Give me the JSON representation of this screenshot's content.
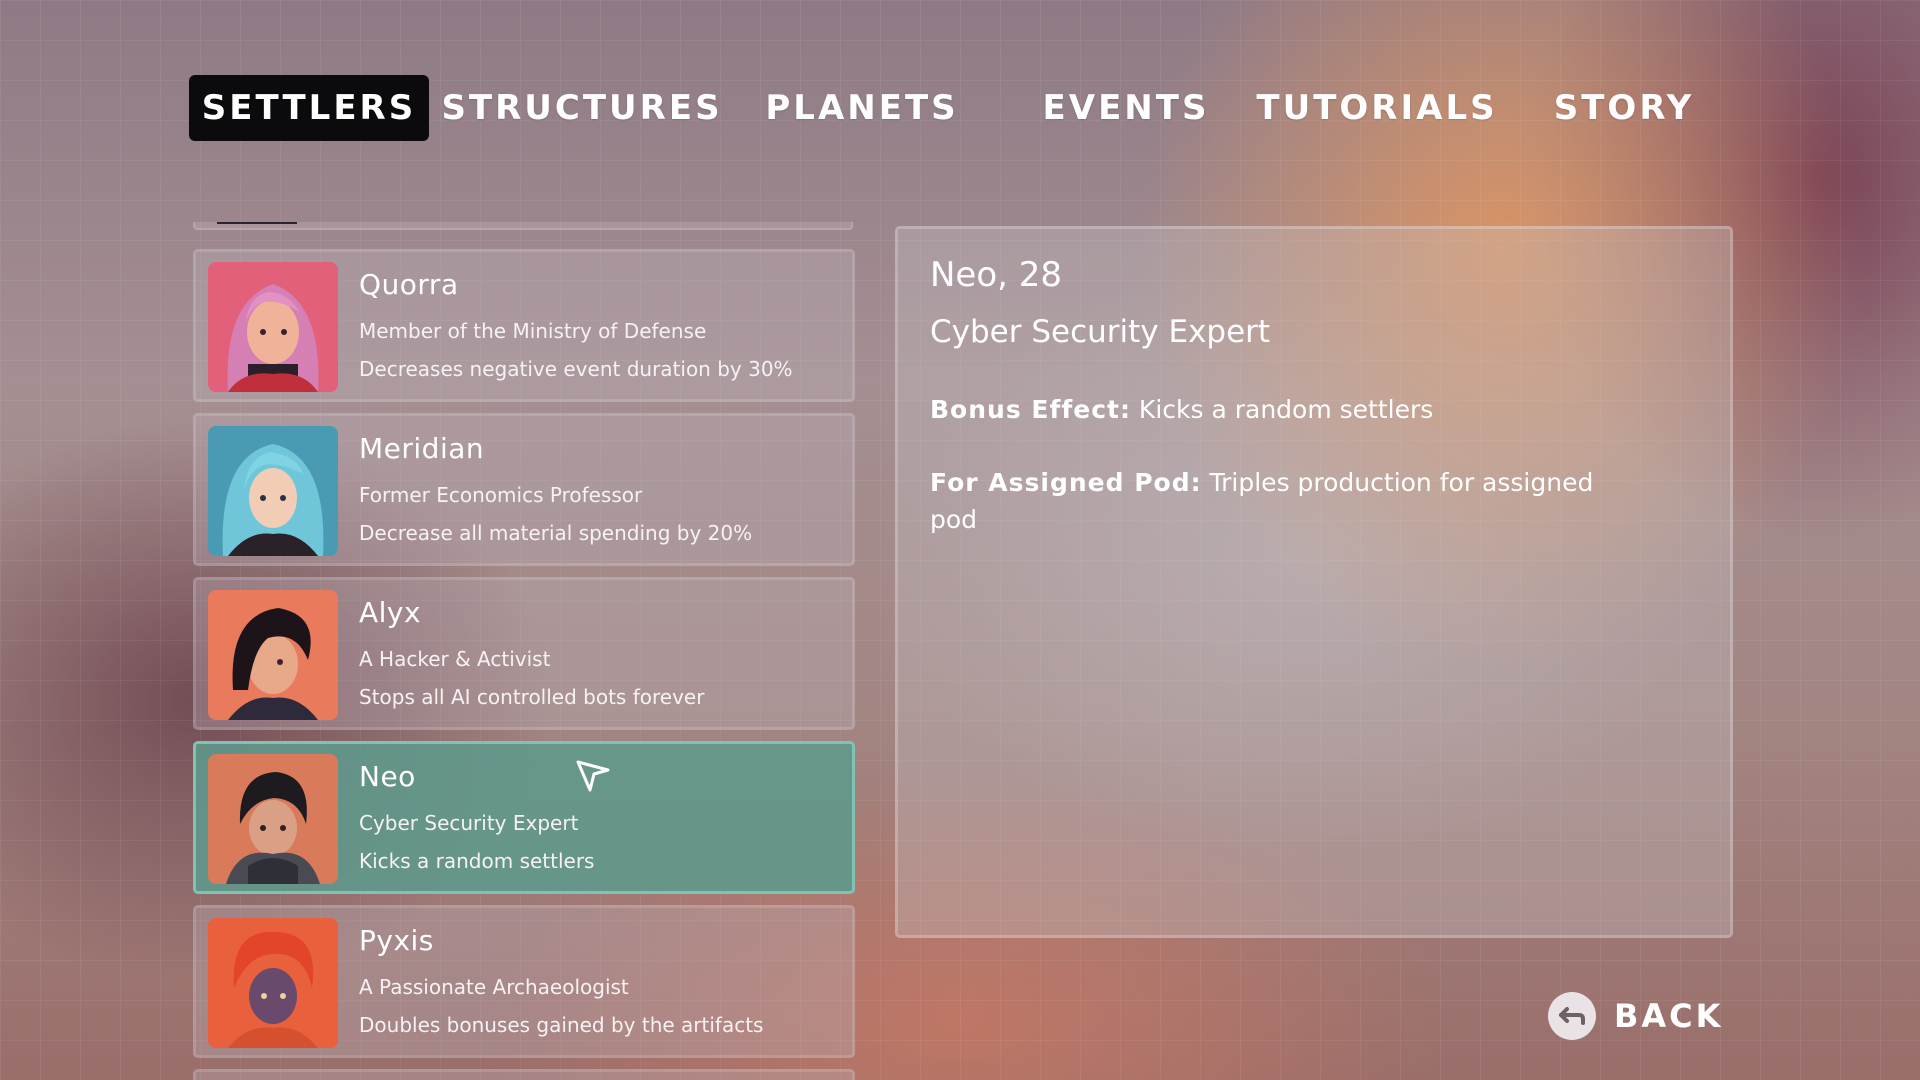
{
  "tabs": [
    {
      "label": "SETTLERS",
      "active": true
    },
    {
      "label": "STRUCTURES",
      "active": false
    },
    {
      "label": "PLANETS",
      "active": false
    },
    {
      "label": "EVENTS",
      "active": false
    },
    {
      "label": "TUTORIALS",
      "active": false
    },
    {
      "label": "STORY",
      "active": false
    }
  ],
  "settlers": [
    {
      "name": "Quorra",
      "role": "Member of the Ministry of Defense",
      "effect": "Decreases negative event duration by 30%",
      "portrait": "quorra-portrait"
    },
    {
      "name": "Meridian",
      "role": "Former Economics Professor",
      "effect": "Decrease all material spending by 20%",
      "portrait": "meridian-portrait"
    },
    {
      "name": "Alyx",
      "role": "A Hacker & Activist",
      "effect": "Stops all AI controlled bots forever",
      "portrait": "alyx-portrait"
    },
    {
      "name": "Neo",
      "role": "Cyber Security Expert",
      "effect": "Kicks a random settlers",
      "portrait": "neo-portrait",
      "selected": true
    },
    {
      "name": "Pyxis",
      "role": "A Passionate Archaeologist",
      "effect": "Doubles bonuses gained by the artifacts",
      "portrait": "pyxis-portrait"
    }
  ],
  "detail": {
    "name_age": "Neo, 28",
    "role": "Cyber Security Expert",
    "bonus_label": "Bonus Effect:",
    "bonus_text": "Kicks a random settlers",
    "pod_label": "For Assigned Pod:",
    "pod_text": "Triples production for assigned pod"
  },
  "back": {
    "label": "BACK",
    "icon": "back-arrow-icon"
  },
  "colors": {
    "selected_card": "#5e988c",
    "active_tab": "#0b0b0d",
    "text": "#ffffff"
  }
}
